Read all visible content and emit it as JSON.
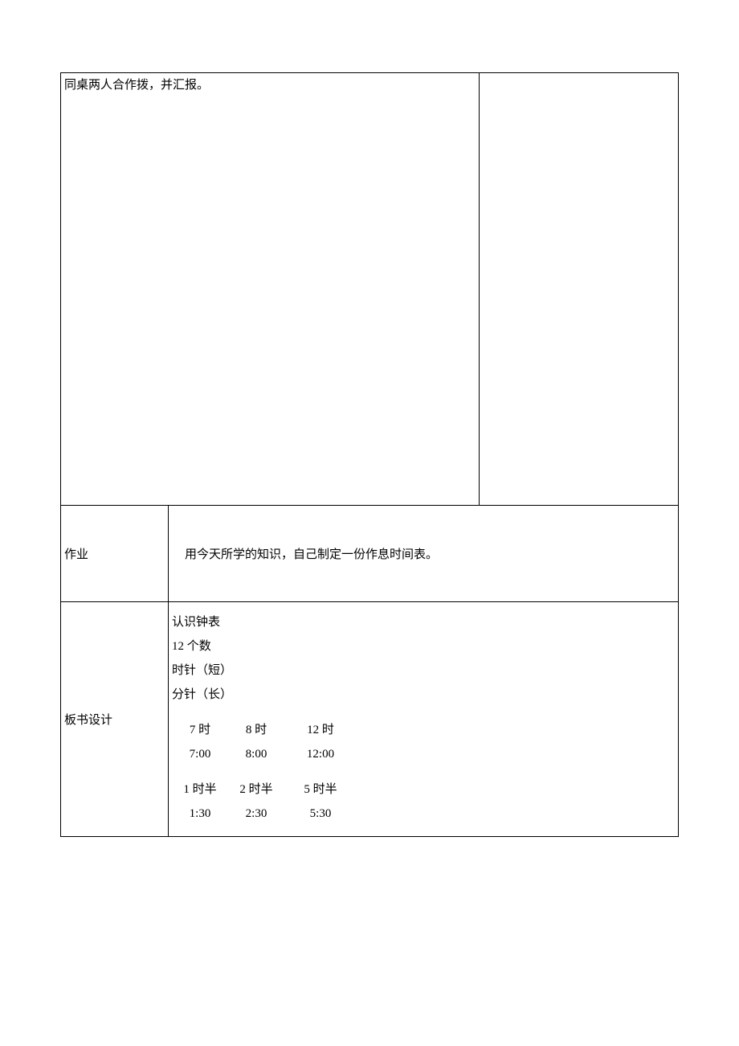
{
  "row1": {
    "left_text": "同桌两人合作拨，并汇报。"
  },
  "row2": {
    "label": "作业",
    "content": "用今天所学的知识，自己制定一份作息时间表。"
  },
  "row3": {
    "label": "板书设计",
    "content": {
      "line1": "认识钟表",
      "line2": "12 个数",
      "line3": "时针（短）",
      "line4": "分针（长）",
      "times_a": {
        "c1": "7 时",
        "c2": "8 时",
        "c3": "12 时"
      },
      "times_b": {
        "c1": "7:00",
        "c2": "8:00",
        "c3": "12:00"
      },
      "times_c": {
        "c1": "1 时半",
        "c2": "2 时半",
        "c3": "5 时半"
      },
      "times_d": {
        "c1": "1:30",
        "c2": "2:30",
        "c3": "5:30"
      }
    }
  }
}
